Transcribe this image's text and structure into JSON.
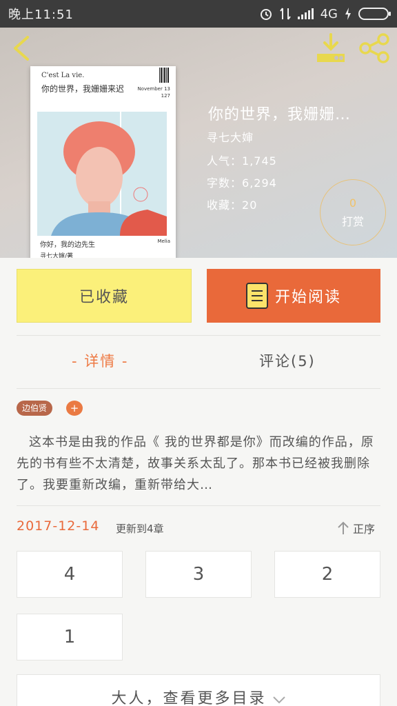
{
  "status_bar": {
    "time": "晚上11:51",
    "network": "4G"
  },
  "book": {
    "title": "你的世界，我姗姗…",
    "author": "寻七大婶",
    "popularity_label": "人气：",
    "popularity": "1,745",
    "word_count_label": "字数：",
    "word_count": "6,294",
    "favorites_label": "收藏：",
    "favorites": "20",
    "reward_count": "0",
    "reward_label": "打赏",
    "cover": {
      "line1": "C'est La vie.",
      "line2": "你的世界，我姗姗来迟",
      "date": "November 13",
      "number": "127",
      "bottom_line1": "你好，我的边先生",
      "bottom_line2": "寻七大婶/著",
      "sign": "Melia"
    }
  },
  "actions": {
    "collect_label": "已收藏",
    "read_label": "开始阅读"
  },
  "tabs": {
    "detail": "- 详情 -",
    "comments": "评论(5)"
  },
  "tags": [
    "边伯贤"
  ],
  "description": "这本书是由我的作品《 我的世界都是你》而改编的作品，原先的书有些不太清楚，故事关系太乱了。那本书已经被我删除了。我要重新改编，重新带给大…",
  "update": {
    "date": "2017-12-14",
    "text": "更新到4章",
    "sort_label": "正序"
  },
  "chapters": [
    "4",
    "3",
    "2",
    "1"
  ],
  "more_label": "大人，查看更多目录",
  "colors": {
    "accent": "#e9693a",
    "collect_bg": "#fbf07a",
    "tag_bg": "#b8674a"
  }
}
